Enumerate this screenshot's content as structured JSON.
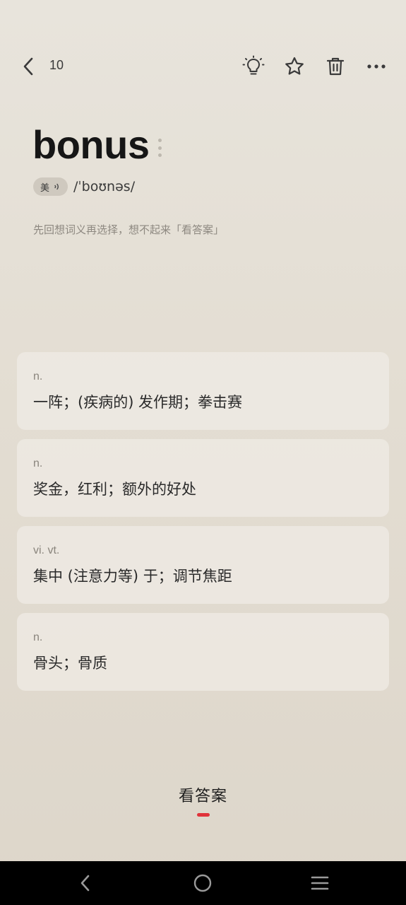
{
  "header": {
    "counter": "10",
    "icons": {
      "back": "chevron-left-icon",
      "hint": "lightbulb-icon",
      "favorite": "star-icon",
      "delete": "trash-icon",
      "more": "more-horizontal-icon"
    }
  },
  "word": {
    "text": "bonus",
    "accent_label": "美",
    "phonetic": "/ˈboʊnəs/"
  },
  "hint": "先回想词义再选择，想不起来「看答案」",
  "options": [
    {
      "pos": "n.",
      "meaning": "一阵；(疾病的) 发作期；拳击赛"
    },
    {
      "pos": "n.",
      "meaning": "奖金，红利；额外的好处"
    },
    {
      "pos": "vi.  vt.",
      "meaning": "集中 (注意力等) 于；调节焦距"
    },
    {
      "pos": "n.",
      "meaning": "骨头；骨质"
    }
  ],
  "answer_button": {
    "label": "看答案",
    "accent_color": "#e0323a"
  },
  "system_nav": {
    "back": "triangle-back-icon",
    "home": "circle-home-icon",
    "menu": "hamburger-menu-icon"
  },
  "colors": {
    "background": "#e5e0d7",
    "card": "#efebe5",
    "accent": "#e0323a"
  }
}
